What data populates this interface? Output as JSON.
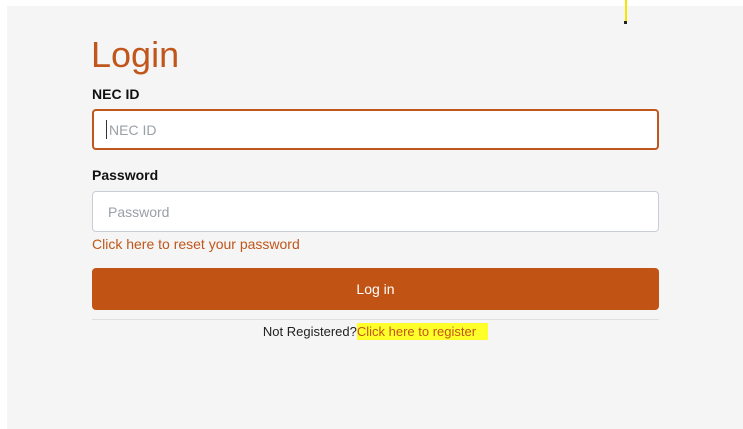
{
  "login": {
    "title": "Login",
    "nec_id_label": "NEC ID",
    "nec_id_placeholder": "NEC ID",
    "nec_id_value": "",
    "password_label": "Password",
    "password_placeholder": "Password",
    "password_value": "",
    "reset_link": "Click here to reset your password",
    "submit_label": "Log in",
    "not_registered_text": "Not Registered?",
    "register_link": "Click here to register"
  },
  "colors": {
    "accent": "#c0561b",
    "button": "#c15414",
    "highlight": "#ffff2a",
    "background": "#f5f5f5"
  }
}
